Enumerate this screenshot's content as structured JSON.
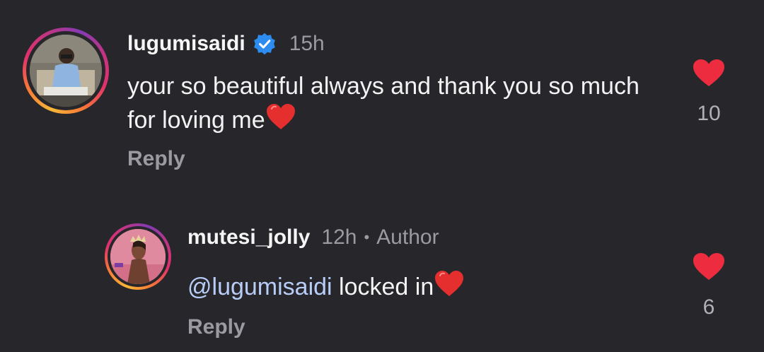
{
  "comments": [
    {
      "username": "lugumisaidi",
      "verified": true,
      "time": "15h",
      "text": "your so beautiful always and thank you so much for loving me",
      "reply_label": "Reply",
      "like_count": "10"
    },
    {
      "username": "mutesi_jolly",
      "time": "12h",
      "dot": "•",
      "badge": "Author",
      "mention": "@lugumisaidi",
      "text": " locked in",
      "reply_label": "Reply",
      "like_count": "6"
    }
  ],
  "colors": {
    "background": "#27272b",
    "heart": "#ed2d3f",
    "mention": "#b7cdf7",
    "verified": "#2d8cf0"
  }
}
